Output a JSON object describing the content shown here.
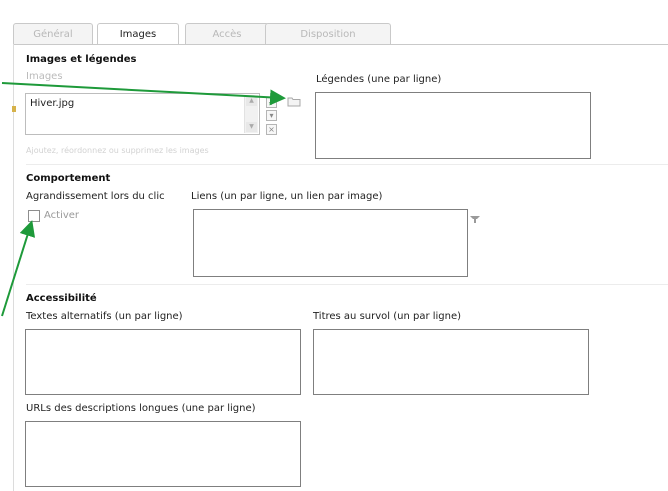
{
  "tabs": [
    {
      "label": "Général",
      "active": false
    },
    {
      "label": "Images",
      "active": true
    },
    {
      "label": "Accès",
      "active": false
    },
    {
      "label": "Disposition",
      "active": false
    }
  ],
  "images_section": {
    "title": "Images et légendes",
    "images_label": "Images",
    "images_list": [
      "Hiver.jpg"
    ],
    "hint": "Ajoutez, réordonnez ou supprimez les images",
    "captions_label": "Légendes (une par ligne)"
  },
  "behavior_section": {
    "title": "Comportement",
    "zoom_label": "Agrandissement lors du clic",
    "activate_label": "Activer",
    "activate_checked": false,
    "links_label": "Liens (un par ligne, un lien par image)"
  },
  "accessibility_section": {
    "title": "Accessibilité",
    "alt_texts_label": "Textes alternatifs (un par ligne)",
    "hover_titles_label": "Titres au survol (un par ligne)",
    "long_desc_label": "URLs des descriptions longues (une par ligne)"
  },
  "colors": {
    "arrow": "#1e9a3a",
    "tab_border": "#c9c9c9"
  }
}
